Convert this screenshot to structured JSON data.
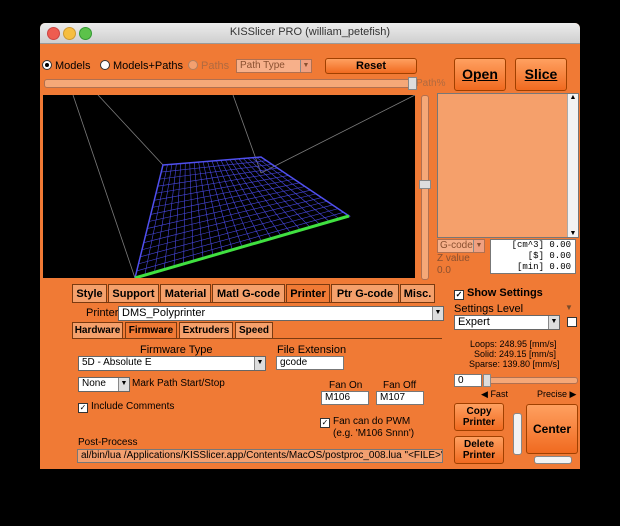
{
  "window": {
    "title": "KISSlicer PRO (william_petefish)"
  },
  "view_mode": {
    "models": "Models",
    "models_paths": "Models+Paths",
    "paths": "Paths",
    "path_type": "Path Type",
    "path_pct": "Path%"
  },
  "buttons": {
    "reset": "Reset",
    "open": "Open",
    "slice": "Slice",
    "copy_printer": "Copy Printer",
    "delete_printer": "Delete Printer",
    "center": "Center"
  },
  "stats": {
    "gcode": "G-code",
    "z_value": "Z value",
    "z_val": "0.0",
    "vol": "[cm^3] 0.00",
    "cost": "[$] 0.00",
    "time": "[min] 0.00"
  },
  "settings": {
    "show": "Show Settings",
    "level_label": "Settings Level",
    "level": "Expert",
    "loops": "Loops:  248.95 [mm/s]",
    "solid": "Solid:  249.15 [mm/s]",
    "sparse": "Sparse:  139.80 [mm/s]",
    "slider_val": "0",
    "fast": "Fast",
    "precise": "Precise"
  },
  "tabs": [
    "Style",
    "Support",
    "Material",
    "Matl G-code",
    "Printer",
    "Ptr G-code",
    "Misc."
  ],
  "printer": {
    "label": "Printer",
    "value": "DMS_Polyprinter"
  },
  "subtabs": [
    "Hardware",
    "Firmware",
    "Extruders",
    "Speed"
  ],
  "firmware": {
    "type_label": "Firmware Type",
    "type_value": "5D - Absolute E",
    "ext_label": "File Extension",
    "ext_value": "gcode",
    "mark_value": "None",
    "mark_label": "Mark Path Start/Stop",
    "comments_label": "Include Comments",
    "fan_on_label": "Fan On",
    "fan_on": "M106",
    "fan_off_label": "Fan Off",
    "fan_off": "M107",
    "pwm_label": "Fan can do PWM",
    "pwm_hint": "(e.g. 'M106 Snnn')",
    "post_label": "Post-Process",
    "post_value": "al/bin/lua /Applications/KISSlicer.app/Contents/MacOS/postproc_008.lua \"<FILE>\""
  },
  "colors": {
    "accent": "#f07a35",
    "viewport": "#000000",
    "bed": "#3a3ad0",
    "front_edge": "#40e040"
  }
}
